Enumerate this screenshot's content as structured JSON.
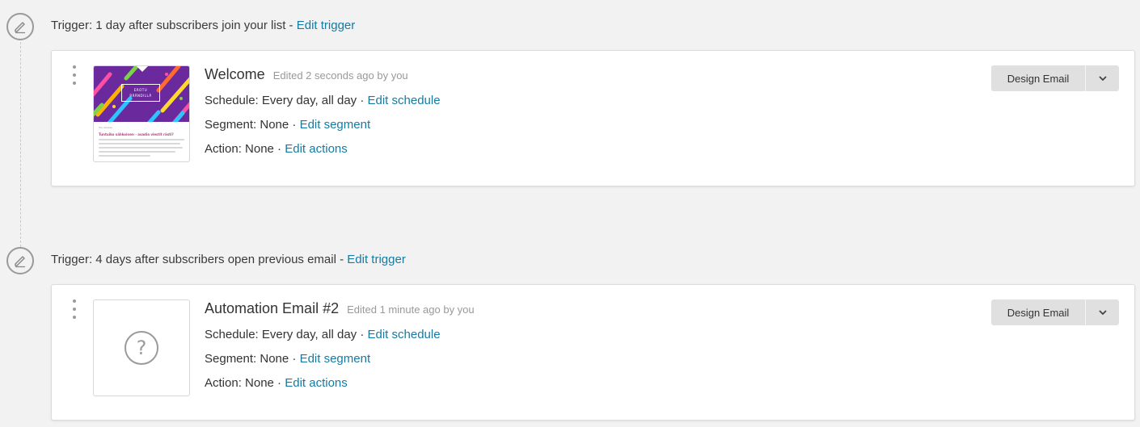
{
  "steps": [
    {
      "trigger_prefix": "Trigger: 1 day after subscribers join your list - ",
      "trigger_link": "Edit trigger",
      "email": {
        "title": "Welcome",
        "edited": "Edited 2 seconds ago by you",
        "schedule_label": "Schedule: Every day, all day · ",
        "schedule_link": "Edit schedule",
        "segment_label": "Segment: None · ",
        "segment_link": "Edit segment",
        "action_label": "Action: None · ",
        "action_link": "Edit actions",
        "thumbnail": {
          "logo_text_line1": "EROTU",
          "logo_text_line2": "BRÄNDILLÄ",
          "small_text": "Hei asiakas",
          "heading": "Tuntuiko sähkoinen - asadia viestit rästi?"
        }
      }
    },
    {
      "trigger_prefix": "Trigger: 4 days after subscribers open previous email - ",
      "trigger_link": "Edit trigger",
      "email": {
        "title": "Automation Email #2",
        "edited": "Edited 1 minute ago by you",
        "schedule_label": "Schedule: Every day, all day · ",
        "schedule_link": "Edit schedule",
        "segment_label": "Segment: None · ",
        "segment_link": "Edit segment",
        "action_label": "Action: None · ",
        "action_link": "Edit actions",
        "placeholder_glyph": "?"
      }
    }
  ],
  "buttons": {
    "design_email": "Design Email"
  },
  "colors": {
    "link": "#157ba2",
    "background": "#f2f2f2",
    "thumbnail_bg": "#6a2a9e"
  },
  "icons": {
    "trigger": "pencil-circle-icon",
    "menu": "kebab-menu-icon",
    "dropdown": "chevron-down-icon",
    "placeholder": "question-circle-icon"
  }
}
